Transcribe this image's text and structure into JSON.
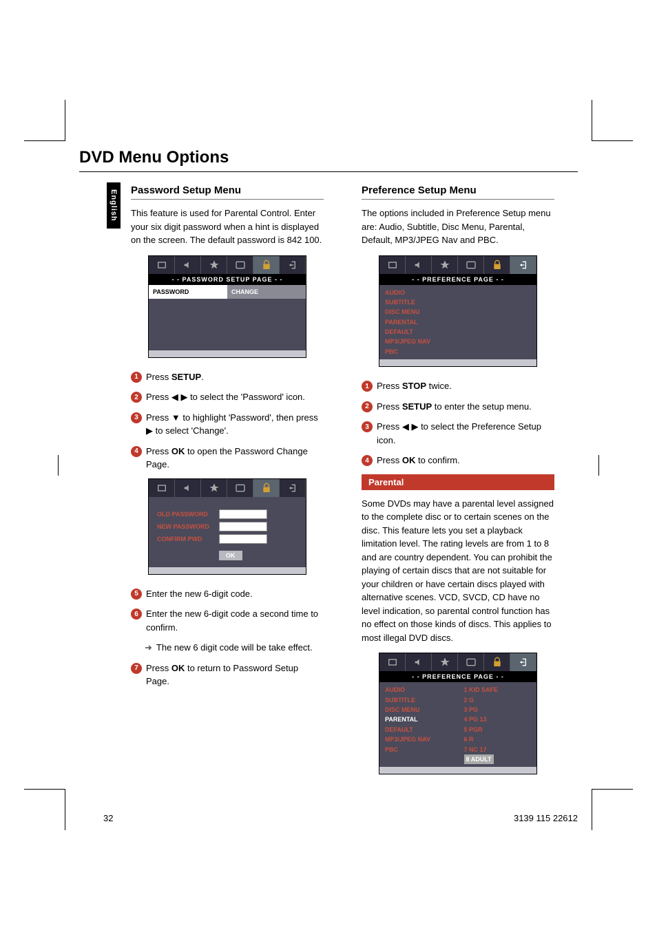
{
  "pageTitle": "DVD Menu Options",
  "sideTab": "English",
  "left": {
    "sectionTitle": "Password Setup Menu",
    "intro": "This feature is used for Parental Control. Enter your six digit password when a hint is displayed on the screen. The default password is 842 100.",
    "menu1": {
      "header": "- -  PASSWORD  SETUP  PAGE  - -",
      "cellLeft": "PASSWORD",
      "cellRight": "CHANGE"
    },
    "steps1": [
      {
        "n": "1",
        "html": "Press <b>SETUP</b>."
      },
      {
        "n": "2",
        "html": "Press <span class='arrow'>◀ ▶</span> to select the 'Password' icon."
      },
      {
        "n": "3",
        "html": "Press <span class='arrow'>▼</span> to highlight 'Password', then press <span class='arrow'>▶</span> to select 'Change'."
      },
      {
        "n": "4",
        "html": "Press <b>OK</b> to open the Password Change Page."
      }
    ],
    "changeFields": {
      "old": "OLD PASSWORD",
      "new": "NEW PASSWORD",
      "confirm": "CONFIRM PWD",
      "ok": "OK"
    },
    "steps2": [
      {
        "n": "5",
        "html": "Enter the new 6-digit code."
      },
      {
        "n": "6",
        "html": "Enter the new 6-digit code a second time to confirm."
      }
    ],
    "result": "The new 6 digit code will be take effect.",
    "steps3": [
      {
        "n": "7",
        "html": "Press <b>OK</b> to return to Password Setup Page."
      }
    ]
  },
  "right": {
    "sectionTitle": "Preference Setup Menu",
    "intro": "The options included in Preference Setup menu are: Audio, Subtitle, Disc Menu, Parental, Default, MP3/JPEG Nav and PBC.",
    "menu1": {
      "header": "- -  PREFERENCE  PAGE  - -",
      "items": [
        "AUDIO",
        "SUBTITLE",
        "DISC MENU",
        "PARENTAL",
        "DEFAULT",
        "MP3/JPEG NAV",
        "PBC"
      ]
    },
    "steps1": [
      {
        "n": "1",
        "html": "Press <b>STOP</b> twice."
      },
      {
        "n": "2",
        "html": "Press <b>SETUP</b> to enter the setup menu."
      },
      {
        "n": "3",
        "html": "Press <span class='arrow'>◀ ▶</span> to select the Preference Setup icon."
      },
      {
        "n": "4",
        "html": "Press <b>OK</b> to confirm."
      }
    ],
    "subSection": "Parental",
    "parentalText": "Some DVDs may have a parental level assigned to the complete disc or to certain scenes on the disc.  This feature lets you set a playback limitation level. The rating levels are from 1 to 8 and are country dependent.  You can prohibit the playing of certain discs that are not suitable for your children or have certain discs played with alternative scenes. VCD, SVCD, CD have no level indication, so parental control function has no effect on those kinds of discs. This applies to most illegal DVD discs.",
    "menu2": {
      "header": "- -  PREFERENCE  PAGE  - -",
      "leftItems": [
        "AUDIO",
        "SUBTITLE",
        "DISC MENU",
        "PARENTAL",
        "DEFAULT",
        "MP3/JPEG NAV",
        "PBC"
      ],
      "leftSelected": "PARENTAL",
      "rightItems": [
        "1  KID SAFE",
        "2  G",
        "3  PG",
        "4  PG 13",
        "5  PGR",
        "6  R",
        "7  NC 17",
        "8  ADULT"
      ],
      "rightSelected": "8  ADULT"
    }
  },
  "pageNumber": "32",
  "docId": "3139 115 22612"
}
